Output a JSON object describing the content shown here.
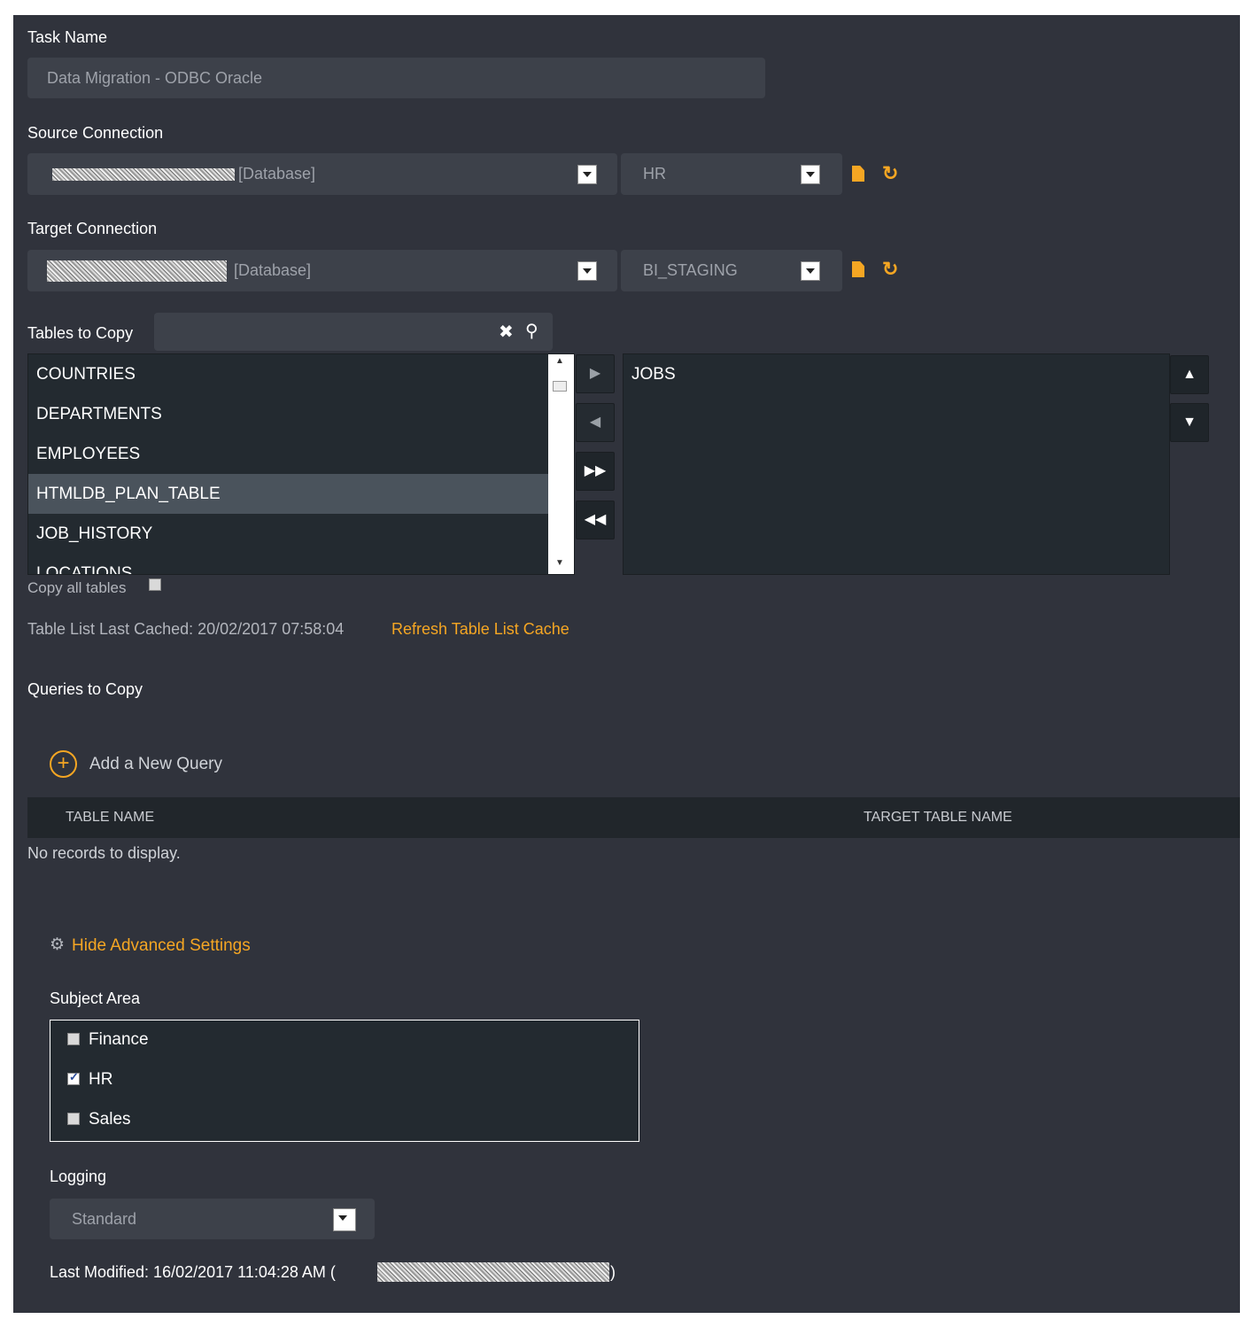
{
  "task_name": {
    "label": "Task Name",
    "value": "Data Migration - ODBC Oracle"
  },
  "source_connection": {
    "label": "Source Connection",
    "connection_suffix": "[Database]",
    "schema": "HR"
  },
  "target_connection": {
    "label": "Target Connection",
    "connection_suffix": "[Database]",
    "schema": "BI_STAGING"
  },
  "tables_to_copy": {
    "label": "Tables to Copy",
    "search_value": "",
    "available": [
      "COUNTRIES",
      "DEPARTMENTS",
      "EMPLOYEES",
      "HTMLDB_PLAN_TABLE",
      "JOB_HISTORY",
      "LOCATIONS"
    ],
    "selected_index": 3,
    "chosen": [
      "JOBS"
    ],
    "copy_all_label": "Copy all tables",
    "copy_all_checked": false,
    "cache_text": "Table List Last Cached: 20/02/2017 07:58:04",
    "refresh_link": "Refresh Table List Cache"
  },
  "queries": {
    "label": "Queries to Copy",
    "add_label": "Add a New Query",
    "columns": [
      "TABLE NAME",
      "TARGET TABLE NAME"
    ],
    "empty_text": "No records to display."
  },
  "advanced": {
    "toggle_label": "Hide Advanced Settings",
    "subject_area_label": "Subject Area",
    "subject_areas": [
      {
        "name": "Finance",
        "checked": false
      },
      {
        "name": "HR",
        "checked": true
      },
      {
        "name": "Sales",
        "checked": false
      }
    ],
    "logging_label": "Logging",
    "logging_value": "Standard",
    "last_modified": "Last Modified: 16/02/2017 11:04:28 AM (",
    "last_modified_close": ")"
  },
  "colors": {
    "panel": "#30333c",
    "field": "#3d414a",
    "accent": "#f5a623",
    "list": "#232a30"
  }
}
